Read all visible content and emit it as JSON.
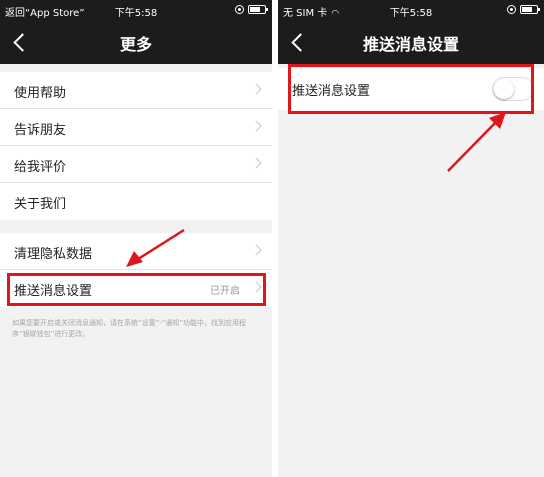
{
  "left": {
    "status": {
      "left": "返回“App Store”",
      "time": "下午5:58"
    },
    "nav": {
      "title": "更多"
    },
    "group1": [
      "使用帮助",
      "告诉朋友",
      "给我评价",
      "关于我们"
    ],
    "group2": [
      "清理隐私数据",
      "推送消息设置"
    ],
    "push_value": "已开启",
    "hint": "如果您要开启或关闭消息通知，请在系统“设置”-“通知”功能中，找到应用程序“银联钱包”进行更改。"
  },
  "right": {
    "status": {
      "left": "无 SIM 卡",
      "time": "下午5:58"
    },
    "nav": {
      "title": "推送消息设置"
    },
    "row_label": "推送消息设置",
    "toggle_on": false
  },
  "colors": {
    "bar": "#1c1c1c",
    "background": "#f2f2f2",
    "highlight": "#e0161b"
  }
}
